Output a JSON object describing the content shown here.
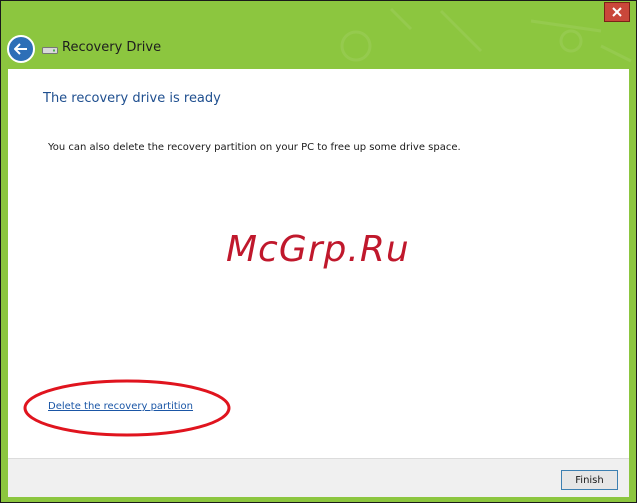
{
  "window": {
    "title": "Recovery Drive",
    "accent_color": "#8cc63f"
  },
  "icons": {
    "back": "back-arrow-icon",
    "drive": "drive-icon",
    "close": "close-icon"
  },
  "content": {
    "heading": "The recovery drive is ready",
    "body": "You can also delete the recovery partition on your PC to free up some drive space.",
    "delete_link": "Delete the recovery partition"
  },
  "watermark": "McGrp.Ru",
  "footer": {
    "finish_label": "Finish"
  }
}
